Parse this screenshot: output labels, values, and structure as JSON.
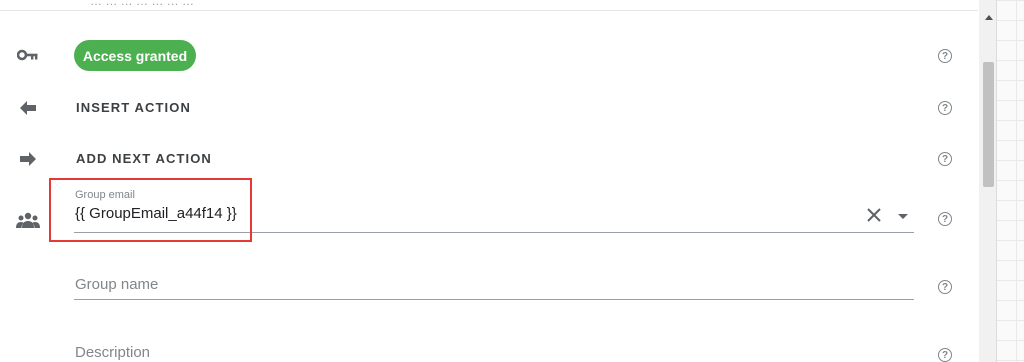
{
  "top_text": "…  … … …  … … …",
  "status_chip": {
    "label": "Access granted",
    "color": "#4caf50"
  },
  "actions": [
    {
      "label": "INSERT ACTION",
      "icon": "arrow-left-icon"
    },
    {
      "label": "ADD NEXT ACTION",
      "icon": "arrow-right-icon"
    }
  ],
  "fields": {
    "group_email": {
      "label": "Group email",
      "value": "{{ GroupEmail_a44f14 }}"
    },
    "group_name": {
      "placeholder": "Group name"
    },
    "description": {
      "placeholder": "Description"
    }
  },
  "icons": {
    "key": "key-icon",
    "group": "group-icon",
    "help": "help-icon",
    "clear": "clear-icon",
    "dropdown": "dropdown-arrow-icon"
  },
  "help_glyph": "?",
  "highlight_color": "#e53935"
}
